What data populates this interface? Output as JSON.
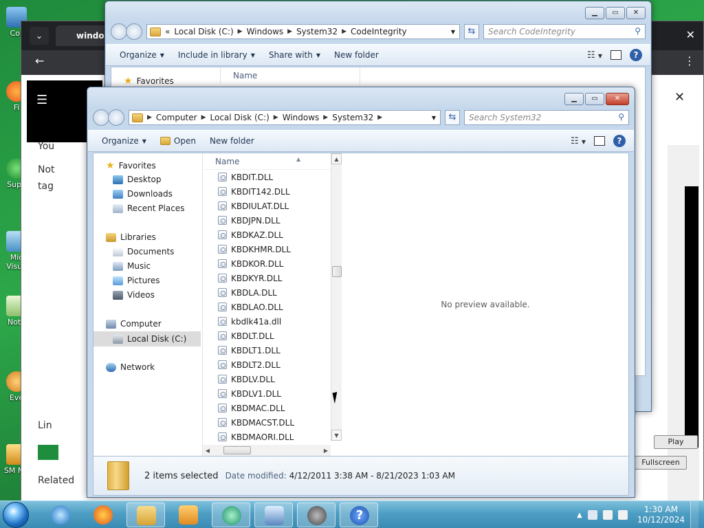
{
  "desktop": {
    "icons": [
      {
        "label": "Cor"
      },
      {
        "label": "Fi"
      },
      {
        "label": "Supe"
      },
      {
        "label": "Mic Visua"
      },
      {
        "label": "Note"
      },
      {
        "label": "Eve"
      },
      {
        "label": "SM Ma"
      }
    ]
  },
  "browser": {
    "tab_title": "window",
    "texts": [
      "You",
      "Not",
      "tag",
      "Lin",
      "Related"
    ],
    "media_play": "Play",
    "media_fullscreen": "Fullscreen"
  },
  "back_window": {
    "path": [
      "«",
      "Local Disk (C:)",
      "Windows",
      "System32",
      "CodeIntegrity"
    ],
    "search_placeholder": "Search CodeIntegrity",
    "toolbar": {
      "organize": "Organize",
      "include": "Include in library",
      "share": "Share with",
      "new_folder": "New folder"
    },
    "column_name": "Name",
    "nav_favorites": "Favorites"
  },
  "front_window": {
    "path": [
      "Computer",
      "Local Disk (C:)",
      "Windows",
      "System32"
    ],
    "search_placeholder": "Search System32",
    "toolbar": {
      "organize": "Organize",
      "open": "Open",
      "new_folder": "New folder"
    },
    "nav": {
      "favorites": "Favorites",
      "desktop": "Desktop",
      "downloads": "Downloads",
      "recent": "Recent Places",
      "libraries": "Libraries",
      "documents": "Documents",
      "music": "Music",
      "pictures": "Pictures",
      "videos": "Videos",
      "computer": "Computer",
      "local_disk": "Local Disk (C:)",
      "network": "Network"
    },
    "column_name": "Name",
    "files": [
      "KBDIT.DLL",
      "KBDIT142.DLL",
      "KBDIULAT.DLL",
      "KBDJPN.DLL",
      "KBDKAZ.DLL",
      "KBDKHMR.DLL",
      "KBDKOR.DLL",
      "KBDKYR.DLL",
      "KBDLA.DLL",
      "KBDLAO.DLL",
      "kbdlk41a.dll",
      "KBDLT.DLL",
      "KBDLT1.DLL",
      "KBDLT2.DLL",
      "KBDLV.DLL",
      "KBDLV1.DLL",
      "KBDMAC.DLL",
      "KBDMACST.DLL",
      "KBDMAORI.DLL"
    ],
    "preview_text": "No preview available.",
    "details": {
      "selected": "2 items selected",
      "modified_label": "Date modified:",
      "modified_value": "4/12/2011 3:38 AM - 8/21/2023 1:03 AM"
    }
  },
  "taskbar": {
    "time": "1:30 AM",
    "date": "10/12/2024"
  }
}
